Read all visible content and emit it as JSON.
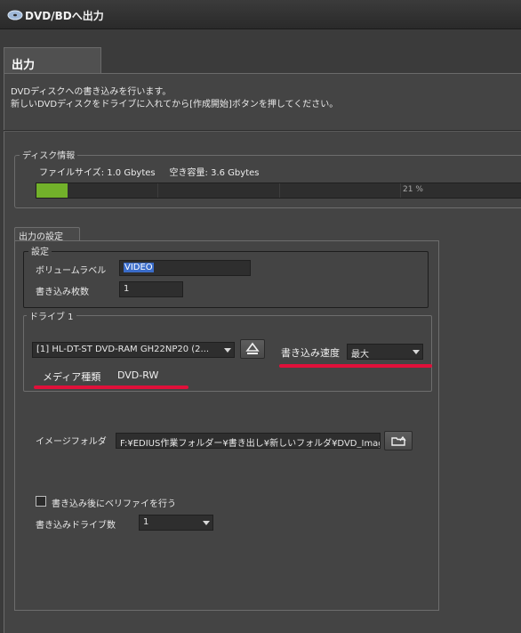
{
  "window": {
    "title": "DVD/BDへ出力",
    "icon": "disc-icon"
  },
  "tab": {
    "label": "出力"
  },
  "description": {
    "line1": "DVDディスクへの書き込みを行います。",
    "line2": "新しいDVDディスクをドライブに入れてから[作成開始]ボタンを押してください。"
  },
  "disk_info": {
    "legend": "ディスク情報",
    "file_size_text": "ファイルサイズ: 1.0 Gbytes",
    "free_space_text": "空き容量: 3.6 Gbytes",
    "progress_label": "21 %",
    "progress_fraction": 0.21,
    "progress_color": "#72b12a"
  },
  "output_settings": {
    "tab_label": "出力の設定",
    "settings_group": {
      "legend": "設定",
      "volume_label": "ボリュームラベル",
      "volume_value": "VIDEO",
      "copies_label": "書き込み枚数",
      "copies_value": "1"
    },
    "drive_group": {
      "legend": "ドライブ 1",
      "drive_selected": "[1] HL-DT-ST DVD-RAM GH22NP20 (2...",
      "eject_icon": "eject-icon",
      "speed_label": "書き込み速度",
      "speed_value": "最大",
      "media_type_label": "メディア種類",
      "media_type_value": "DVD-RW",
      "highlight_color": "#e0103a"
    },
    "image_folder": {
      "label": "イメージフォルダ",
      "value": "F:¥EDIUS作業フォルダー¥書き出し¥新しいフォルダ¥DVD_Image",
      "browse_icon": "folder-open-icon"
    },
    "verify": {
      "label": "書き込み後にベリファイを行う",
      "checked": false
    },
    "drive_count": {
      "label": "書き込みドライブ数",
      "value": "1"
    }
  }
}
